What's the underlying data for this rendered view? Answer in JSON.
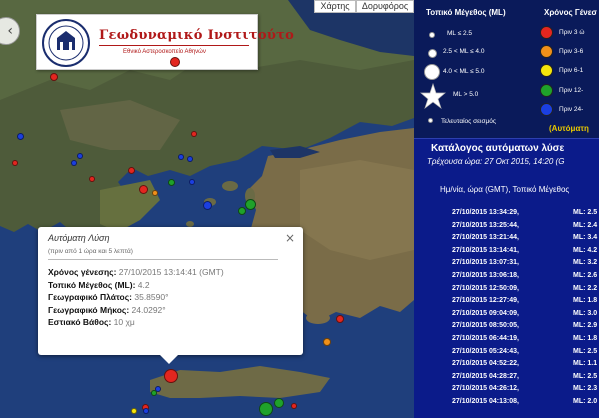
{
  "map": {
    "controls": {
      "roadmap": "Χάρτης",
      "satellite": "Δορυφόρος"
    },
    "logo": {
      "title": "Γεωδυναμικό Ινστιτούτο",
      "subtitle": "Εθνικό Αστεροσκοπείο Αθηνών"
    },
    "markers": [
      {
        "color": "#e3261f",
        "size": 10
      },
      {
        "color": "#e3261f",
        "size": 8
      },
      {
        "color": "#1b3fe0",
        "size": 7
      },
      {
        "color": "#e3261f",
        "size": 6
      },
      {
        "color": "#1b3fe0",
        "size": 6
      },
      {
        "color": "#1b3fe0",
        "size": 6
      },
      {
        "color": "#e3261f",
        "size": 6
      },
      {
        "color": "#e3261f",
        "size": 7
      },
      {
        "color": "#e3261f",
        "size": 9
      },
      {
        "color": "#f0901a",
        "size": 6
      },
      {
        "color": "#1fa22a",
        "size": 7
      },
      {
        "color": "#1b3fe0",
        "size": 6
      },
      {
        "color": "#1b3fe0",
        "size": 6
      },
      {
        "color": "#e3261f",
        "size": 6
      },
      {
        "color": "#1b3fe0",
        "size": 6
      },
      {
        "color": "#1b3fe0",
        "size": 9
      },
      {
        "color": "#1fa22a",
        "size": 11
      },
      {
        "color": "#1fa22a",
        "size": 8
      },
      {
        "color": "#1b3fe0",
        "size": 6
      },
      {
        "color": "#1b3fe0",
        "size": 6
      },
      {
        "color": "#e3261f",
        "size": 8
      },
      {
        "color": "#f0901a",
        "size": 8
      },
      {
        "color": "#e3261f",
        "size": 14
      },
      {
        "color": "#1b3fe0",
        "size": 6
      },
      {
        "color": "#1fa22a",
        "size": 6
      },
      {
        "color": "#e3261f",
        "size": 7
      },
      {
        "color": "#f5e50b",
        "size": 6
      },
      {
        "color": "#1b3fe0",
        "size": 6
      },
      {
        "color": "#1fa22a",
        "size": 14
      },
      {
        "color": "#1fa22a",
        "size": 10
      },
      {
        "color": "#e3261f",
        "size": 6
      }
    ],
    "popup": {
      "title": "Αυτόματη Λύση",
      "subtitle": "(πριν από 1 ώρα και 5 λεπτά)",
      "rows": [
        {
          "label": "Χρόνος γένεσης:",
          "value": "27/10/2015  13:14:41 (GMT)"
        },
        {
          "label": "Τοπικό Μέγεθος (ML):",
          "value": "4.2"
        },
        {
          "label": "Γεωγραφικό Πλάτος:",
          "value": "35.8590°"
        },
        {
          "label": "Γεωγραφικό Μήκος:",
          "value": "24.0292°"
        },
        {
          "label": "Εστιακό Βάθος:",
          "value": "10 χμ"
        }
      ]
    }
  },
  "legend": {
    "magnitude_title": "Τοπικό Μέγεθος (ML)",
    "time_title": "Χρόνος Γένεσ",
    "magnitudes": [
      {
        "label": "ML ≤ 2.5"
      },
      {
        "label": "2.5 < ML ≤ 4.0"
      },
      {
        "label": "4.0 < ML ≤ 5.0"
      },
      {
        "label": "ML > 5.0"
      },
      {
        "label": "Τελευταίος σεισμός"
      }
    ],
    "times": [
      {
        "label": "Πριν 3 ώ",
        "color": "#e3261f"
      },
      {
        "label": "Πριν 3-6",
        "color": "#f0901a"
      },
      {
        "label": "Πριν 6-1",
        "color": "#f5e50b"
      },
      {
        "label": "Πριν 12-",
        "color": "#1fa22a"
      },
      {
        "label": "Πριν 24-",
        "color": "#1b3fe0"
      }
    ],
    "auto_label": "(Αυτόματη"
  },
  "catalog": {
    "title": "Κατάλογος αυτόματων λύσε",
    "current_time": "Τρέχουσα ώρα: 27 Οκτ 2015, 14:20 (G",
    "columns": "Ημ/νία, ώρα (GMT), Τοπικό Μέγεθος",
    "entries": [
      {
        "datetime": "27/10/2015 13:34:29,",
        "ml": "ML: 2.5"
      },
      {
        "datetime": "27/10/2015 13:25:44,",
        "ml": "ML: 2.4"
      },
      {
        "datetime": "27/10/2015 13:21:44,",
        "ml": "ML: 3.4"
      },
      {
        "datetime": "27/10/2015 13:14:41,",
        "ml": "ML: 4.2"
      },
      {
        "datetime": "27/10/2015 13:07:31,",
        "ml": "ML: 3.2"
      },
      {
        "datetime": "27/10/2015 13:06:18,",
        "ml": "ML: 2.6"
      },
      {
        "datetime": "27/10/2015 12:50:09,",
        "ml": "ML: 2.2"
      },
      {
        "datetime": "27/10/2015 12:27:49,",
        "ml": "ML: 1.8"
      },
      {
        "datetime": "27/10/2015 09:04:09,",
        "ml": "ML: 3.0"
      },
      {
        "datetime": "27/10/2015 08:50:05,",
        "ml": "ML: 2.9"
      },
      {
        "datetime": "27/10/2015 06:44:19,",
        "ml": "ML: 1.8"
      },
      {
        "datetime": "27/10/2015 05:24:43,",
        "ml": "ML: 2.5"
      },
      {
        "datetime": "27/10/2015 04:52:22,",
        "ml": "ML: 1.1"
      },
      {
        "datetime": "27/10/2015 04:28:27,",
        "ml": "ML: 2.5"
      },
      {
        "datetime": "27/10/2015 04:26:12,",
        "ml": "ML: 2.3"
      },
      {
        "datetime": "27/10/2015 04:13:08,",
        "ml": "ML: 2.0"
      }
    ]
  }
}
